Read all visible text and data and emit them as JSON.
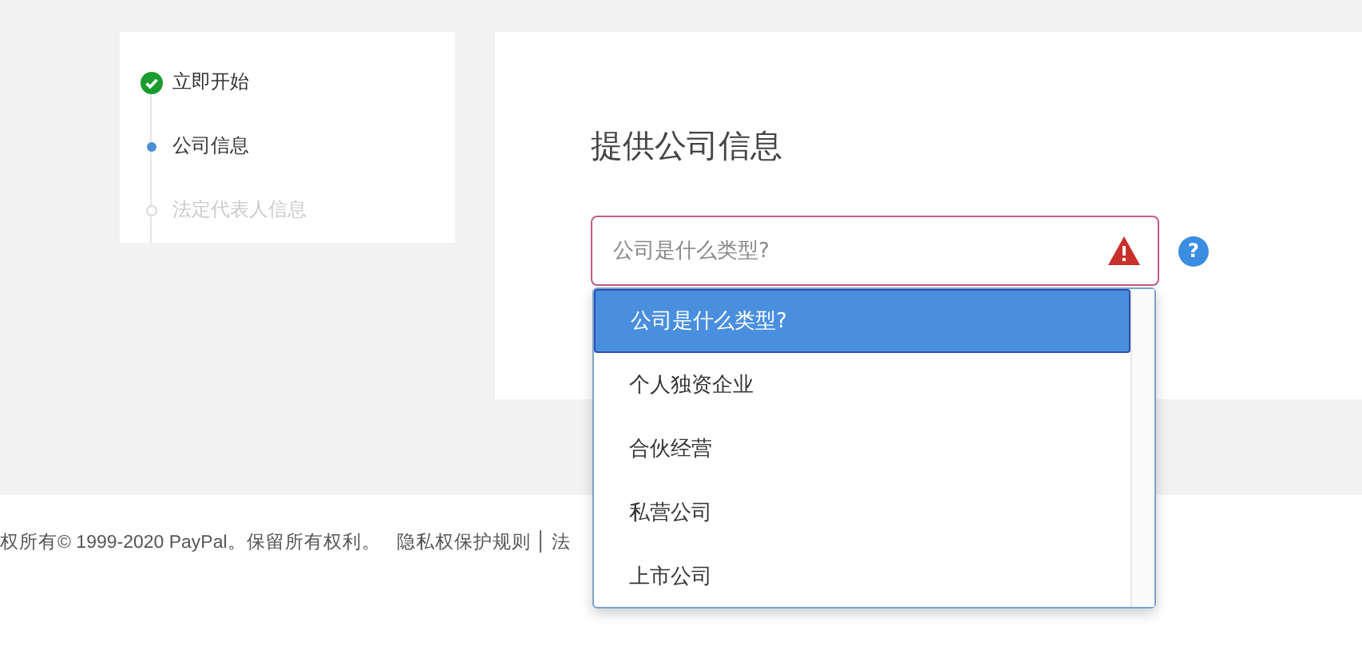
{
  "steps": [
    {
      "label": "立即开始",
      "kind": "done",
      "disabled": false
    },
    {
      "label": "公司信息",
      "kind": "current",
      "disabled": false
    },
    {
      "label": "法定代表人信息",
      "kind": "pending",
      "disabled": true
    }
  ],
  "form": {
    "title": "提供公司信息",
    "select": {
      "placeholder": "公司是什么类型?",
      "error": true,
      "help_icon": "?",
      "options": [
        {
          "label": "公司是什么类型?",
          "selected": true
        },
        {
          "label": "个人独资企业",
          "selected": false
        },
        {
          "label": "合伙经营",
          "selected": false
        },
        {
          "label": "私营公司",
          "selected": false
        },
        {
          "label": "上市公司",
          "selected": false
        }
      ]
    }
  },
  "footer": {
    "copyright": "权所有© 1999-2020 PayPal。保留所有权利。",
    "links": [
      "隐私权保护规则",
      "法"
    ]
  }
}
